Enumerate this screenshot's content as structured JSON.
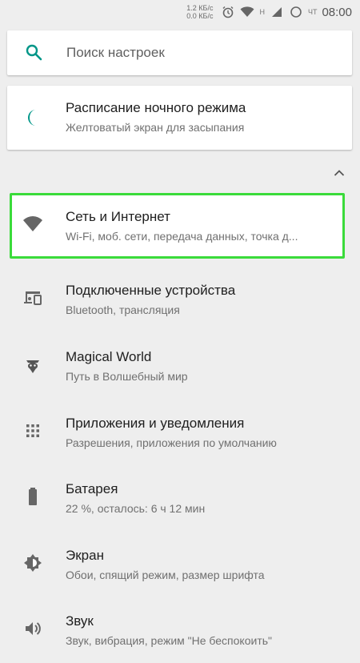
{
  "statusbar": {
    "speed_up": "1.2 КБ/с",
    "speed_down": "0.0 КБ/с",
    "network_label": "H",
    "carrier": "ЧТ",
    "time": "08:00"
  },
  "search": {
    "placeholder": "Поиск настроек"
  },
  "suggestion": {
    "title": "Расписание ночного режима",
    "subtitle": "Желтоватый экран для засыпания"
  },
  "items": [
    {
      "title": "Сеть и Интернет",
      "subtitle": "Wi-Fi, моб. сети, передача данных, точка д..."
    },
    {
      "title": "Подключенные устройства",
      "subtitle": "Bluetooth, трансляция"
    },
    {
      "title": "Magical World",
      "subtitle": "Путь в Волшебный мир"
    },
    {
      "title": "Приложения и уведомления",
      "subtitle": "Разрешения, приложения по умолчанию"
    },
    {
      "title": "Батарея",
      "subtitle": "22 %, осталось: 6 ч 12 мин"
    },
    {
      "title": "Экран",
      "subtitle": "Обои, спящий режим, размер шрифта"
    },
    {
      "title": "Звук",
      "subtitle": "Звук, вибрация, режим \"Не беспокоить\""
    }
  ],
  "colors": {
    "accent": "#009688",
    "highlight": "#3adb3a",
    "icon": "#666666"
  },
  "icons": {
    "search": "search-icon",
    "night": "moon-icon",
    "collapse": "chevron-up-icon",
    "network": "wifi-icon",
    "devices": "devices-icon",
    "magical": "wizard-icon",
    "apps": "apps-grid-icon",
    "battery": "battery-icon",
    "display": "brightness-icon",
    "sound": "volume-icon"
  }
}
